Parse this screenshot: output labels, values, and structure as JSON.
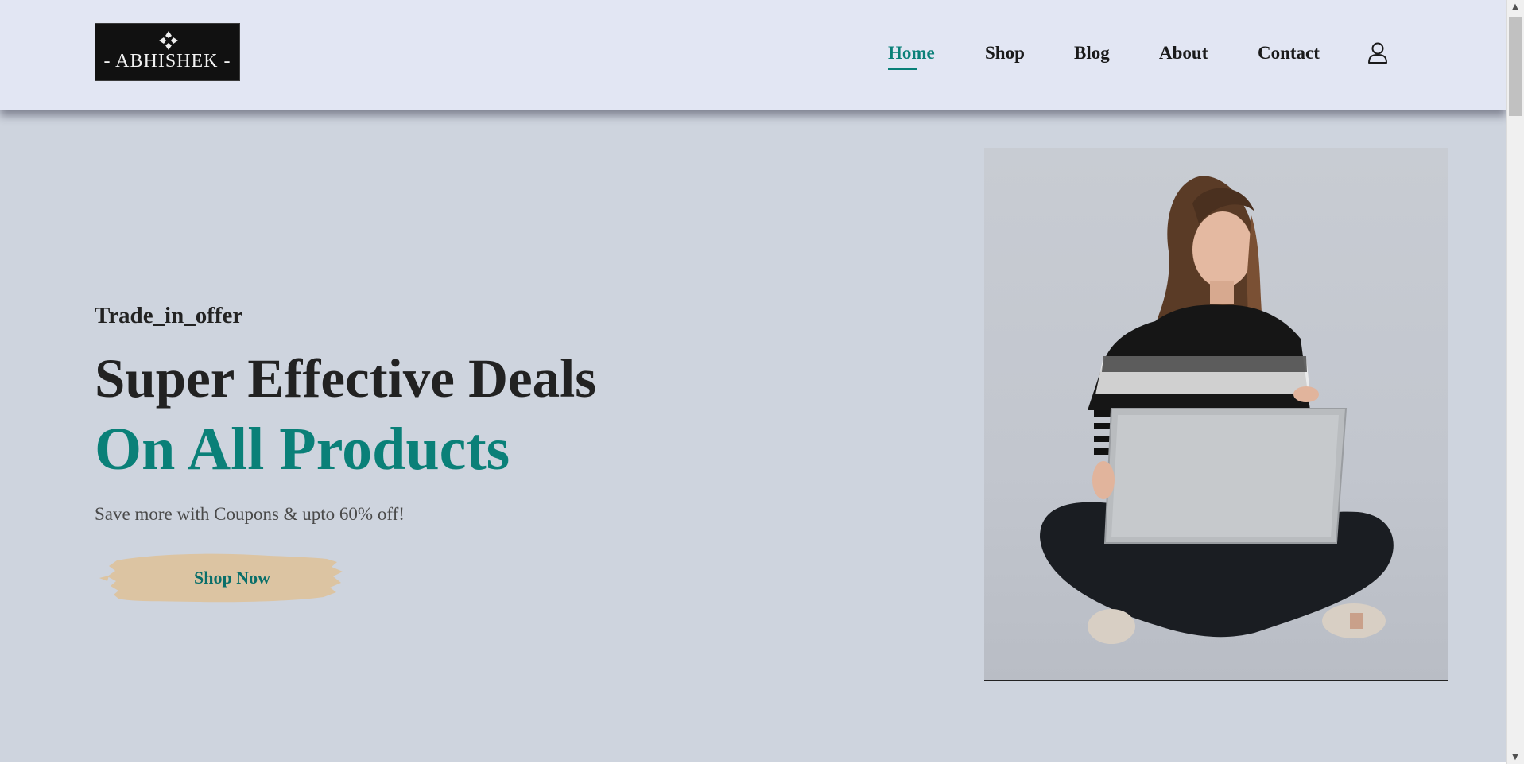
{
  "logo": {
    "text": "- ABHISHEK -"
  },
  "nav": {
    "items": [
      {
        "label": "Home",
        "active": true
      },
      {
        "label": "Shop",
        "active": false
      },
      {
        "label": "Blog",
        "active": false
      },
      {
        "label": "About",
        "active": false
      },
      {
        "label": "Contact",
        "active": false
      }
    ],
    "user_icon": "user-icon"
  },
  "hero": {
    "subtitle": "Trade_in_offer",
    "title": "Super Effective Deals",
    "title_highlight": "On All Products",
    "description": "Save more with Coupons & upto 60% off!",
    "button_label": "Shop Now",
    "image_alt": "woman-with-laptop"
  },
  "colors": {
    "accent": "#0a8078",
    "header_bg": "#e2e6f3",
    "page_bg": "#ced4de",
    "button_brush": "#dcc4a2"
  }
}
